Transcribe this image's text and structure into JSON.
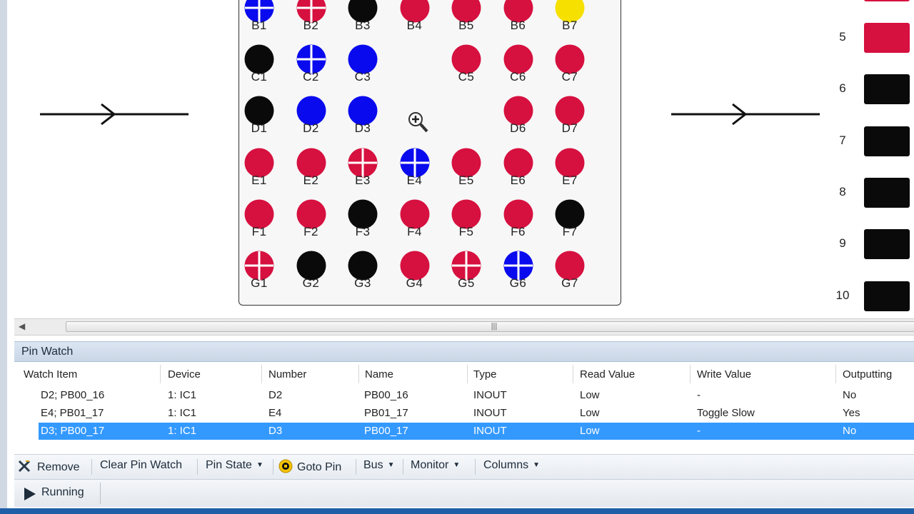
{
  "colors": {
    "red": "#d6103f",
    "blue": "#0a0aee",
    "black": "#0a0a0a",
    "yellow": "#f5e000",
    "selection": "#3399ff"
  },
  "pin_grid": [
    {
      "id": "B1",
      "color": "blue",
      "cross": true
    },
    {
      "id": "B2",
      "color": "red",
      "cross": true
    },
    {
      "id": "B3",
      "color": "black",
      "cross": false
    },
    {
      "id": "B4",
      "color": "red",
      "cross": false
    },
    {
      "id": "B5",
      "color": "red",
      "cross": false
    },
    {
      "id": "B6",
      "color": "red",
      "cross": false
    },
    {
      "id": "B7",
      "color": "yellow",
      "cross": false
    },
    {
      "id": "C1",
      "color": "black",
      "cross": false
    },
    {
      "id": "C2",
      "color": "blue",
      "cross": true
    },
    {
      "id": "C3",
      "color": "blue",
      "cross": false
    },
    {
      "id": "C5",
      "color": "red",
      "cross": false
    },
    {
      "id": "C6",
      "color": "red",
      "cross": false
    },
    {
      "id": "C7",
      "color": "red",
      "cross": false
    },
    {
      "id": "D1",
      "color": "black",
      "cross": false
    },
    {
      "id": "D2",
      "color": "blue",
      "cross": false
    },
    {
      "id": "D3",
      "color": "blue",
      "cross": false
    },
    {
      "id": "D6",
      "color": "red",
      "cross": false
    },
    {
      "id": "D7",
      "color": "red",
      "cross": false
    },
    {
      "id": "E1",
      "color": "red",
      "cross": false
    },
    {
      "id": "E2",
      "color": "red",
      "cross": false
    },
    {
      "id": "E3",
      "color": "red",
      "cross": true
    },
    {
      "id": "E4",
      "color": "blue",
      "cross": true
    },
    {
      "id": "E5",
      "color": "red",
      "cross": false
    },
    {
      "id": "E6",
      "color": "red",
      "cross": false
    },
    {
      "id": "E7",
      "color": "red",
      "cross": false
    },
    {
      "id": "F1",
      "color": "red",
      "cross": false
    },
    {
      "id": "F2",
      "color": "red",
      "cross": false
    },
    {
      "id": "F3",
      "color": "black",
      "cross": false
    },
    {
      "id": "F4",
      "color": "red",
      "cross": false
    },
    {
      "id": "F5",
      "color": "red",
      "cross": false
    },
    {
      "id": "F6",
      "color": "red",
      "cross": false
    },
    {
      "id": "F7",
      "color": "black",
      "cross": false
    },
    {
      "id": "G1",
      "color": "red",
      "cross": true
    },
    {
      "id": "G2",
      "color": "black",
      "cross": false
    },
    {
      "id": "G3",
      "color": "black",
      "cross": false
    },
    {
      "id": "G4",
      "color": "red",
      "cross": false
    },
    {
      "id": "G5",
      "color": "red",
      "cross": true
    },
    {
      "id": "G6",
      "color": "blue",
      "cross": true
    },
    {
      "id": "G7",
      "color": "red",
      "cross": false
    }
  ],
  "pin_legend": [
    {
      "num": "5",
      "color": "red"
    },
    {
      "num": "6",
      "color": "black"
    },
    {
      "num": "7",
      "color": "black"
    },
    {
      "num": "8",
      "color": "black"
    },
    {
      "num": "9",
      "color": "black"
    },
    {
      "num": "10",
      "color": "black"
    }
  ],
  "pin_watch": {
    "title": "Pin Watch",
    "columns": [
      "Watch Item",
      "Device",
      "Number",
      "Name",
      "Type",
      "Read Value",
      "Write Value",
      "Outputting"
    ],
    "rows": [
      {
        "watch_item": "D2; PB00_16",
        "device": "1: IC1",
        "number": "D2",
        "name": "PB00_16",
        "type": "INOUT",
        "read": "Low",
        "write": "-",
        "outputting": "No",
        "selected": false
      },
      {
        "watch_item": "E4; PB01_17",
        "device": "1: IC1",
        "number": "E4",
        "name": "PB01_17",
        "type": "INOUT",
        "read": "Low",
        "write": "Toggle Slow",
        "outputting": "Yes",
        "selected": false
      },
      {
        "watch_item": "D3; PB00_17",
        "device": "1: IC1",
        "number": "D3",
        "name": "PB00_17",
        "type": "INOUT",
        "read": "Low",
        "write": "-",
        "outputting": "No",
        "selected": true
      }
    ]
  },
  "toolbar": {
    "remove": "Remove",
    "clear_pin_watch": "Clear Pin Watch",
    "pin_state": "Pin State",
    "goto_pin": "Goto Pin",
    "bus": "Bus",
    "monitor": "Monitor",
    "columns": "Columns"
  },
  "status": {
    "text": "Running"
  }
}
